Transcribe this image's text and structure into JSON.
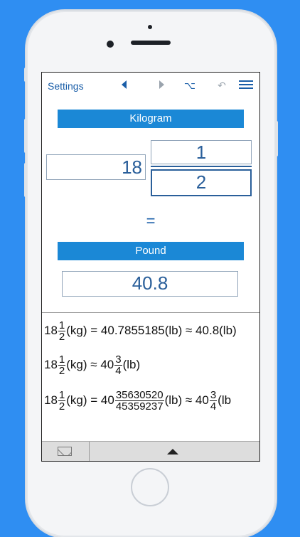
{
  "toolbar": {
    "settings_label": "Settings",
    "icons": [
      "back-arrow-icon",
      "forward-arrow-icon",
      "option-key-icon",
      "undo-icon",
      "menu-icon"
    ]
  },
  "input": {
    "unit": "Kilogram",
    "whole": "18",
    "numerator": "1",
    "denominator": "2"
  },
  "equals_sign": "=",
  "output": {
    "unit": "Pound",
    "value": "40.8"
  },
  "results": {
    "line1": {
      "whole": "18",
      "n": "1",
      "d": "2",
      "rest": "(kg) = 40.7855185(lb) ≈ 40.8(lb)"
    },
    "line2": {
      "whole": "18",
      "n": "1",
      "d": "2",
      "mid": "(kg) ≈ 40",
      "n2": "3",
      "d2": "4",
      "end": "(lb)"
    },
    "line3": {
      "whole": "18",
      "n": "1",
      "d": "2",
      "mid": "(kg) = 40",
      "n2": "35630520",
      "d2": "45359237",
      "end2": "(lb) ≈ 40",
      "n3": "3",
      "d3": "4",
      "end3": "(lb"
    }
  },
  "colors": {
    "background": "#2f8ef2",
    "unit_bar": "#1b88d6",
    "accent_text": "#1a5ea8"
  }
}
